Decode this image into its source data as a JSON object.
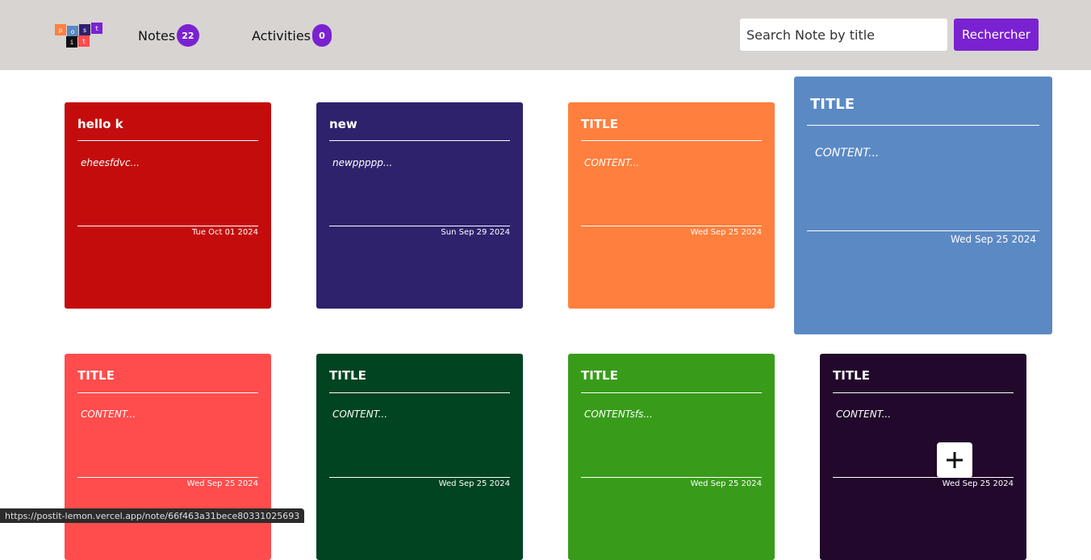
{
  "header": {
    "logo_letters": [
      "p",
      "o",
      "s",
      "t",
      "i",
      "t"
    ],
    "nav": [
      {
        "label": "Notes",
        "count": "22"
      },
      {
        "label": "Activities",
        "count": "0"
      }
    ],
    "search": {
      "placeholder": "Search Note by title",
      "button_label": "Rechercher"
    }
  },
  "notes": [
    {
      "title": "hello k",
      "content": "eheesfdvc...",
      "date": "Tue Oct 01 2024",
      "color": "#c40c0c"
    },
    {
      "title": "new",
      "content": "newppppp...",
      "date": "Sun Sep 29 2024",
      "color": "#2f226d"
    },
    {
      "title": "TITLE",
      "content": "CONTENT...",
      "date": "Wed Sep 25 2024",
      "color": "#ff7f3e"
    },
    {
      "title": "TITLE",
      "content": "CONTENT...",
      "date": "Wed Sep 25 2024",
      "color": "#5b89c4"
    },
    {
      "title": "TITLE",
      "content": "CONTENT...",
      "date": "Wed Sep 25 2024",
      "color": "#ff4c4c"
    },
    {
      "title": "TITLE",
      "content": "CONTENT...",
      "date": "Wed Sep 25 2024",
      "color": "#014421"
    },
    {
      "title": "TITLE",
      "content": "CONTENTsfs...",
      "date": "Wed Sep 25 2024",
      "color": "#389c1a"
    },
    {
      "title": "TITLE",
      "content": "CONTENT...",
      "date": "Wed Sep 25 2024",
      "color": "#22092c"
    }
  ],
  "status_url": "https://postit-lemon.vercel.app/note/66f463a31bece80331025693"
}
